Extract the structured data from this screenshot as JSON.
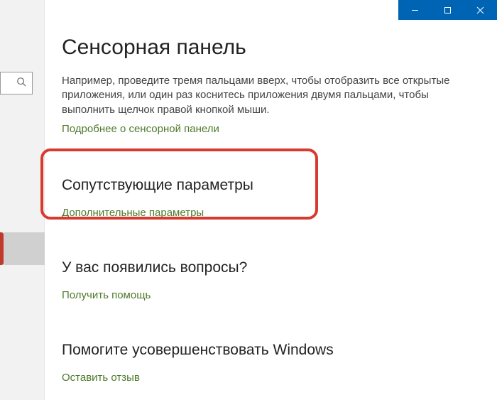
{
  "window": {
    "minimize": "−",
    "maximize": "□",
    "close": "✕"
  },
  "page": {
    "title": "Сенсорная панель",
    "description": "Например, проведите тремя пальцами вверх, чтобы отобразить все открытые приложения, или один раз коснитесь приложения двумя пальцами, чтобы выполнить щелчок правой кнопкой мыши.",
    "learn_more": "Подробнее о сенсорной панели"
  },
  "sections": {
    "related": {
      "heading": "Сопутствующие параметры",
      "link": "Дополнительные параметры"
    },
    "questions": {
      "heading": "У вас появились вопросы?",
      "link": "Получить помощь"
    },
    "feedback": {
      "heading": "Помогите усовершенствовать Windows",
      "link": "Оставить отзыв"
    }
  }
}
